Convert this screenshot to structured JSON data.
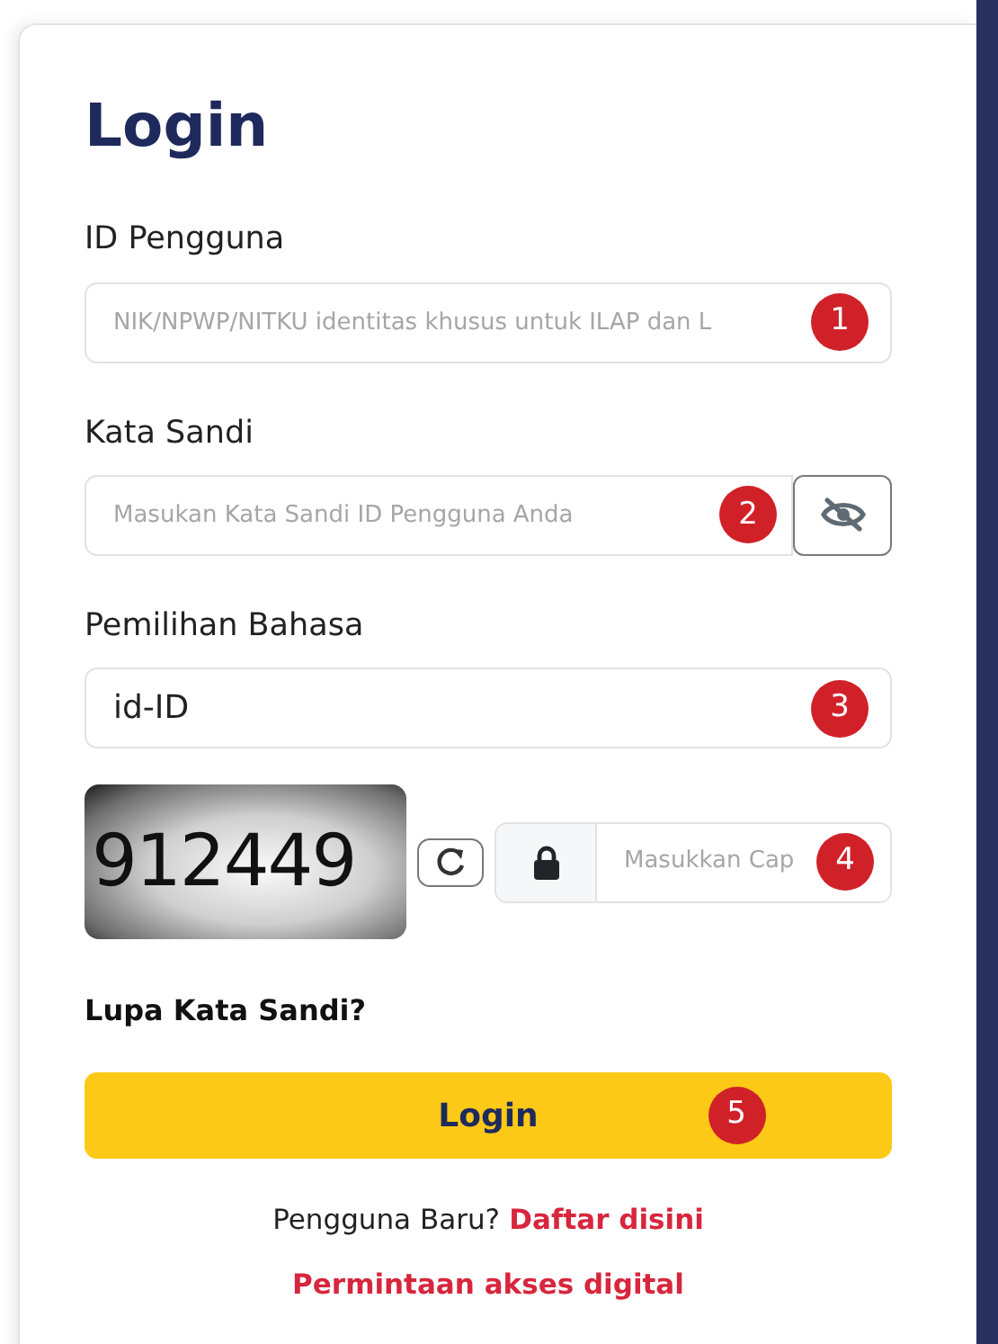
{
  "title": "Login",
  "fields": [
    {
      "kind": "text",
      "label": "ID Pengguna",
      "placeholder": "NIK/NPWP/NITKU identitas khusus untuk ILAP dan L",
      "marker": "1"
    },
    {
      "kind": "password",
      "label": "Kata Sandi",
      "placeholder": "Masukan Kata Sandi ID Pengguna Anda",
      "marker": "2"
    },
    {
      "kind": "select",
      "label": "Pemilihan Bahasa",
      "value": "id-ID",
      "marker": "3"
    }
  ],
  "captcha": {
    "text": "912449",
    "placeholder": "Masukkan Cap",
    "marker": "4"
  },
  "forgot_link": "Lupa Kata Sandi?",
  "login_button": {
    "label": "Login",
    "marker": "5"
  },
  "register": {
    "text": "Pengguna Baru?",
    "link": "Daftar disini"
  },
  "digital_access_link": "Permintaan akses digital"
}
